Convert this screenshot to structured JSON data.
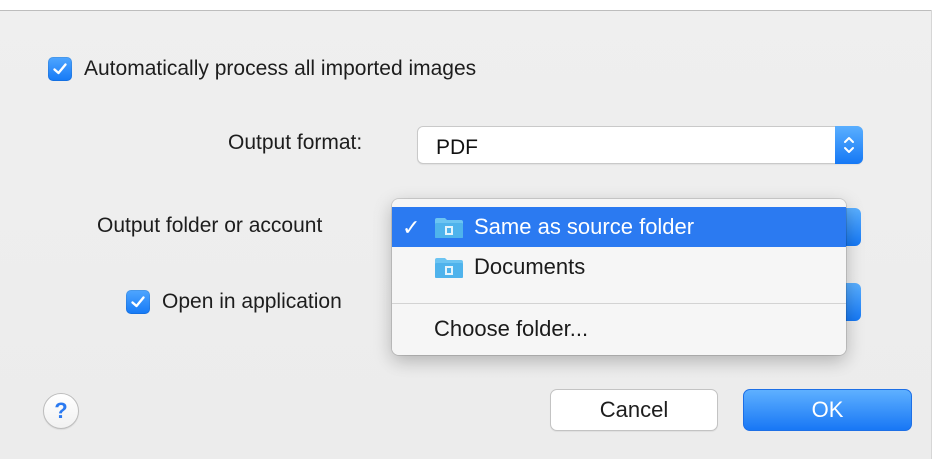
{
  "dialog": {
    "auto_process_label": "Automatically process all imported images",
    "auto_process_checked": true,
    "output_format_label": "Output format:",
    "output_format_value": "PDF",
    "output_folder_label": "Output folder or account",
    "open_in_app_label": "Open in application",
    "open_in_app_checked": true,
    "help_label": "?",
    "cancel_label": "Cancel",
    "ok_label": "OK"
  },
  "folder_menu": {
    "checkmark": "✓",
    "items": [
      {
        "label": "Same as source folder",
        "selected": true,
        "icon": "folder-icon"
      },
      {
        "label": "Documents",
        "selected": false,
        "icon": "folder-icon"
      }
    ],
    "choose_label": "Choose folder..."
  },
  "colors": {
    "accent": "#2b7af1",
    "checkbox": "#1579f6",
    "background": "#ececec"
  }
}
